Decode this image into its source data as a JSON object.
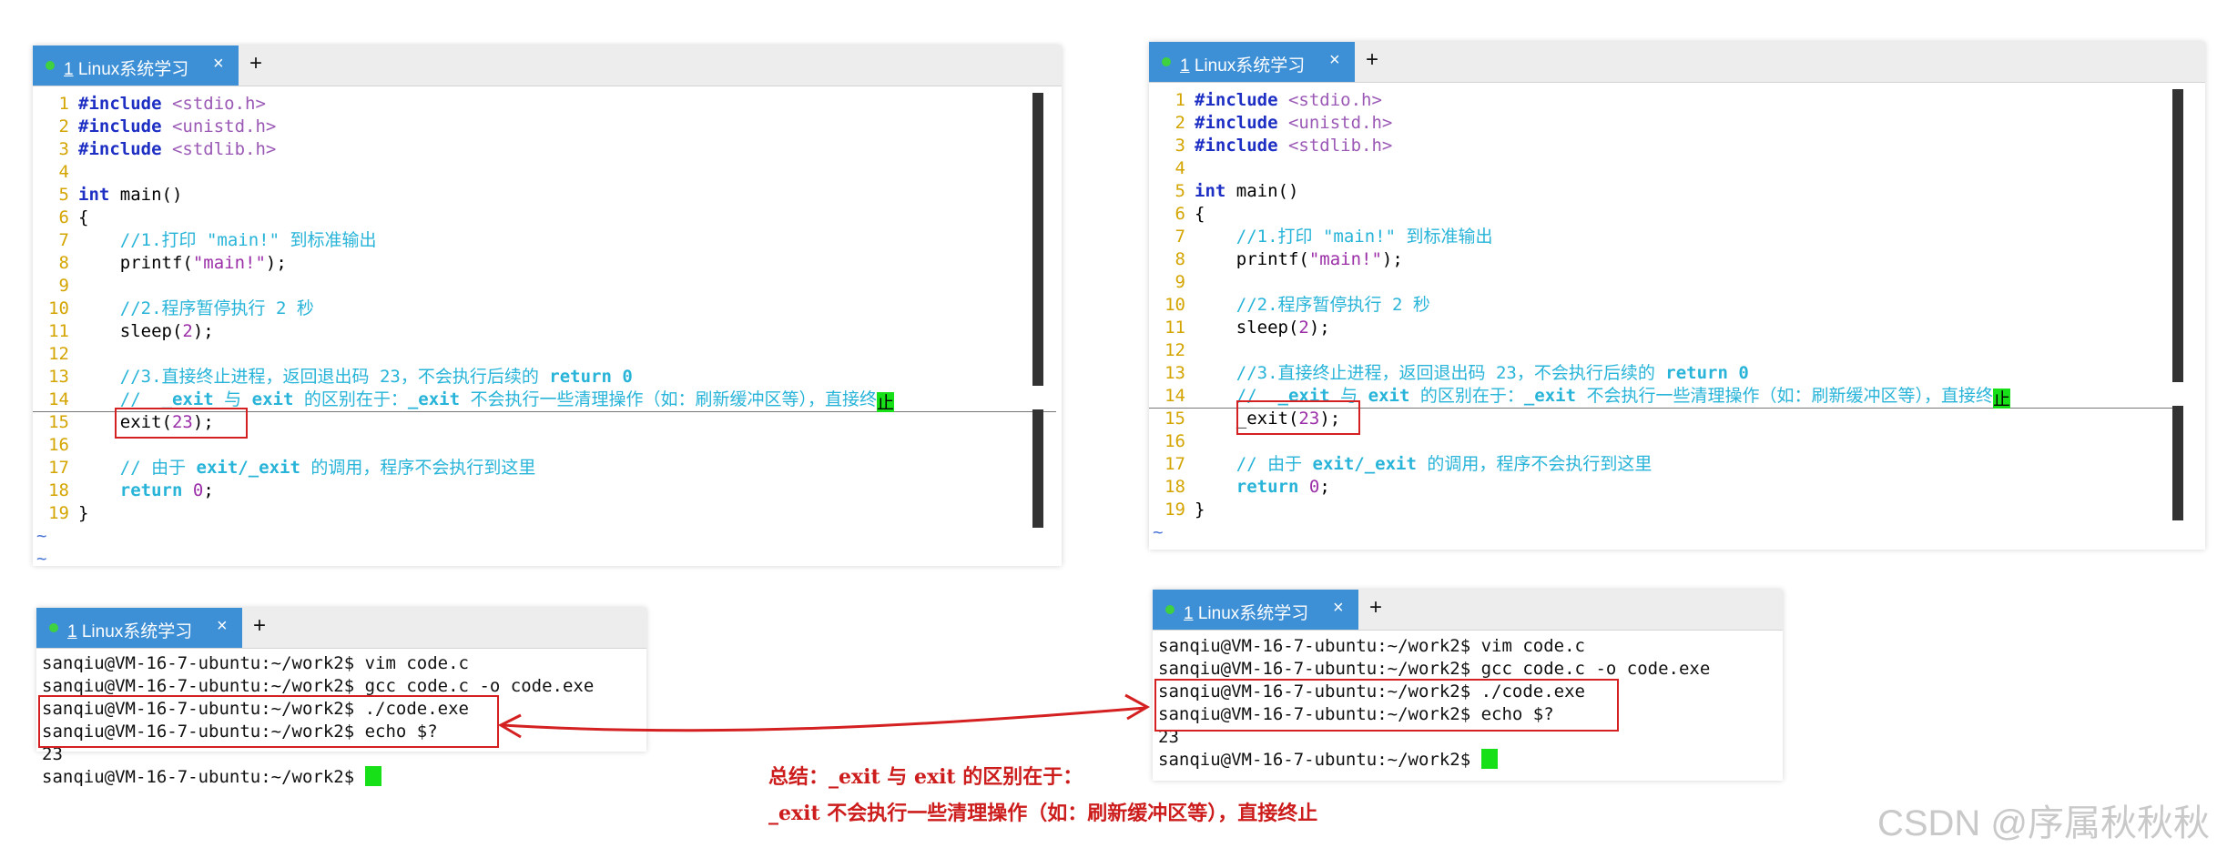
{
  "tab": {
    "number": "1",
    "title": "Linux系统学习",
    "close": "×",
    "new_tab": "+"
  },
  "editor_left": {
    "lines": [
      {
        "n": "1"
      },
      {
        "n": "2"
      },
      {
        "n": "3"
      },
      {
        "n": "4"
      },
      {
        "n": "5"
      },
      {
        "n": "6"
      },
      {
        "n": "7"
      },
      {
        "n": "8"
      },
      {
        "n": "9"
      },
      {
        "n": "10"
      },
      {
        "n": "11"
      },
      {
        "n": "12"
      },
      {
        "n": "13"
      },
      {
        "n": "14"
      },
      {
        "n": "15"
      },
      {
        "n": "16"
      },
      {
        "n": "17"
      },
      {
        "n": "18"
      },
      {
        "n": "19"
      }
    ],
    "exit_call": "exit",
    "line17_fn": "exit/_exit",
    "empty_marker": "~"
  },
  "editor_right": {
    "exit_call": "_exit",
    "line17_fn": "exit/_exit",
    "empty_marker": "~"
  },
  "code": {
    "include": "#include",
    "h1": "<stdio.h>",
    "h2": "<unistd.h>",
    "h3": "<stdlib.h>",
    "int": "int",
    "main": " main()",
    "lbrace": "{",
    "rbrace": "}",
    "c1": "//1.打印 \"main!\" 到标准输出",
    "printf": "printf(",
    "main_str": "\"main!\"",
    "close_semi": ");",
    "c2": "//2.程序暂停执行 2 秒",
    "sleep": "sleep(",
    "two": "2",
    "c3a": "//3.直接终止进程，返回退出码 23，不会执行后续的 ",
    "c3b": "return 0",
    "c4a": "//  ",
    "c4b": "_exit",
    "c4c": " 与 ",
    "c4d": "exit",
    "c4e": " 的区别在于：",
    "c4f": "_exit",
    "c4g": " 不会执行一些清理操作（如：刷新缓冲区等），直接终",
    "c4h": "止",
    "paren": "(",
    "code23": "23",
    "c5a": "// 由于 ",
    "c5b": "exit/_exit",
    "c5c": " 的调用，程序不会执行到这里",
    "return": "return",
    "zero": "0",
    "semi": ";"
  },
  "terminal": {
    "prompt": "sanqiu@VM-16-7-ubuntu:~/work2$",
    "cmd1": " vim code.c",
    "cmd2": " gcc code.c -o code.exe",
    "cmd3": " ./code.exe",
    "cmd4": " echo $?",
    "output": "23"
  },
  "note": {
    "line1": "总结：_exit 与 exit 的区别在于：",
    "line2": "_exit 不会执行一些清理操作（如：刷新缓冲区等），直接终止"
  },
  "watermark": "CSDN @序属秋秋秋",
  "colors": {
    "tab": "#3d8fd6",
    "annotation": "#d42020",
    "cursor": "#18e018"
  }
}
